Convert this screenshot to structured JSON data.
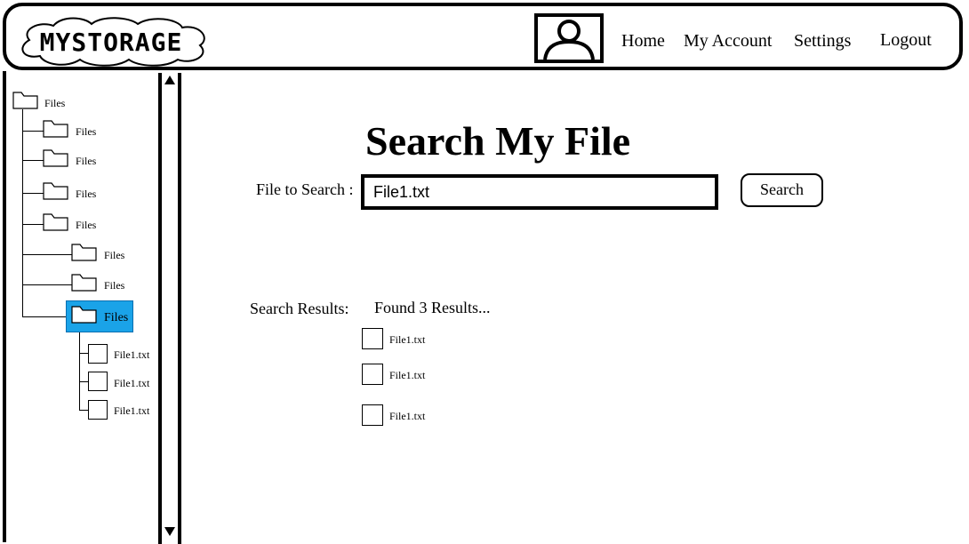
{
  "header": {
    "logo_text": "MYSTORAGE",
    "nav": {
      "home": "Home",
      "my_account": "My Account",
      "settings": "Settings",
      "logout": "Logout"
    }
  },
  "sidebar": {
    "tree": [
      {
        "label": "Files",
        "level": 0
      },
      {
        "label": "Files",
        "level": 1
      },
      {
        "label": "Files",
        "level": 1
      },
      {
        "label": "Files",
        "level": 1
      },
      {
        "label": "Files",
        "level": 1
      },
      {
        "label": "Files",
        "level": 2
      },
      {
        "label": "Files",
        "level": 2
      },
      {
        "label": "Files",
        "level": 2,
        "selected": true
      }
    ],
    "files": [
      "File1.txt",
      "File1.txt",
      "File1.txt"
    ],
    "selected_color": "#1aa3e8"
  },
  "main": {
    "title": "Search My File",
    "search_label": "File to Search :",
    "search_value": "File1.txt",
    "search_button": "Search",
    "results_label": "Search Results:",
    "results_count": "Found 3 Results...",
    "results": [
      "File1.txt",
      "File1.txt",
      "File1.txt"
    ]
  }
}
